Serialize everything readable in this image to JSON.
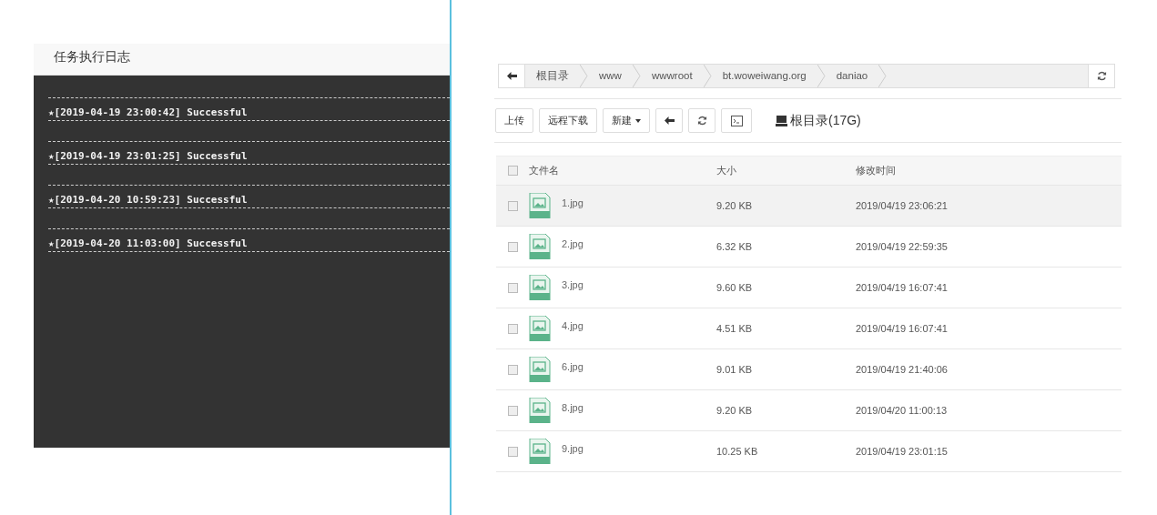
{
  "log_panel": {
    "title": "任务执行日志",
    "entries": [
      {
        "text": "★[2019-04-19 23:00:42] Successful"
      },
      {
        "text": "★[2019-04-19 23:01:25] Successful"
      },
      {
        "text": "★[2019-04-20 10:59:23] Successful"
      },
      {
        "text": "★[2019-04-20 11:03:00] Successful"
      }
    ]
  },
  "file_manager": {
    "breadcrumb": [
      "根目录",
      "www",
      "wwwroot",
      "bt.woweiwang.org",
      "daniao"
    ],
    "toolbar": {
      "upload": "上传",
      "remote_download": "远程下载",
      "new": "新建",
      "disk": "根目录(17G)"
    },
    "table": {
      "select_all_checked": false,
      "columns": [
        "文件名",
        "大小",
        "修改时间"
      ],
      "rows": [
        {
          "name": "1.jpg",
          "size": "9.20 KB",
          "modified": "2019/04/19 23:06:21",
          "selected": true
        },
        {
          "name": "2.jpg",
          "size": "6.32 KB",
          "modified": "2019/04/19 22:59:35",
          "selected": false
        },
        {
          "name": "3.jpg",
          "size": "9.60 KB",
          "modified": "2019/04/19 16:07:41",
          "selected": false
        },
        {
          "name": "4.jpg",
          "size": "4.51 KB",
          "modified": "2019/04/19 16:07:41",
          "selected": false
        },
        {
          "name": "6.jpg",
          "size": "9.01 KB",
          "modified": "2019/04/19 21:40:06",
          "selected": false
        },
        {
          "name": "8.jpg",
          "size": "9.20 KB",
          "modified": "2019/04/20 11:00:13",
          "selected": false
        },
        {
          "name": "9.jpg",
          "size": "10.25 KB",
          "modified": "2019/04/19 23:01:15",
          "selected": false
        }
      ]
    }
  }
}
